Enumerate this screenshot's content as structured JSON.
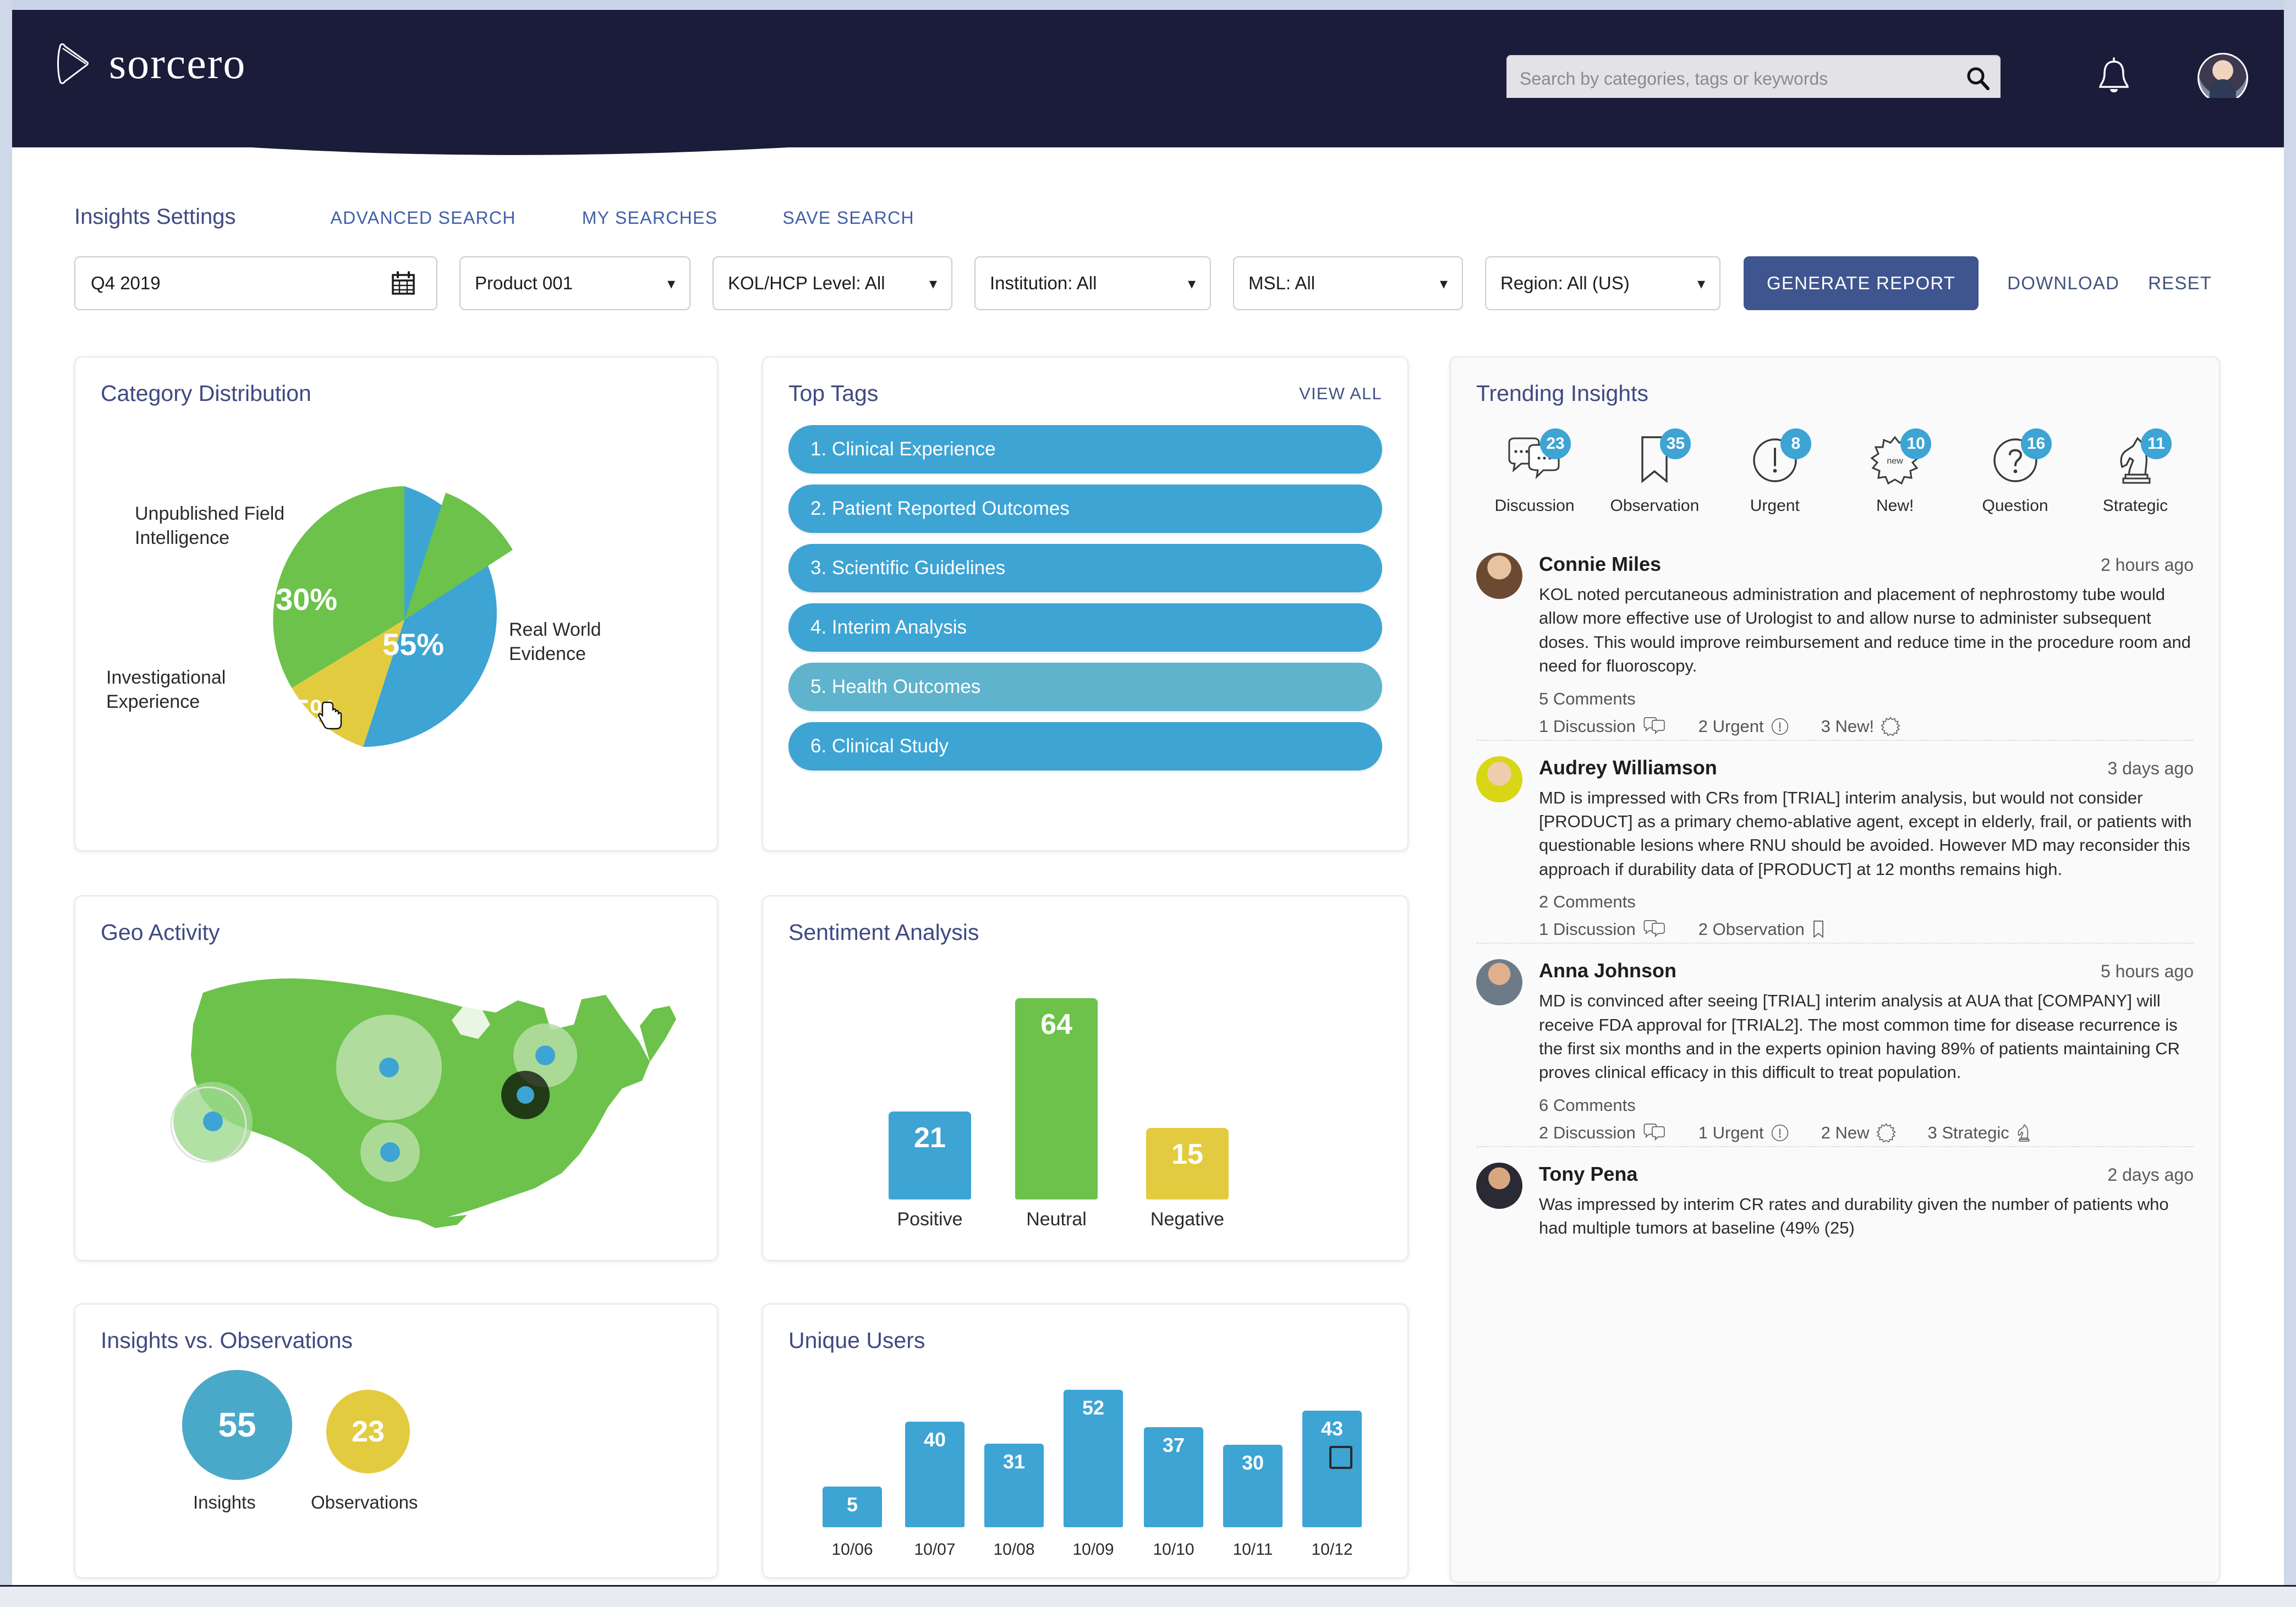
{
  "header": {
    "brand": "sorcero",
    "search_placeholder": "Search by categories, tags or keywords",
    "search_value": "",
    "icons": {
      "search": "search-icon",
      "bell": "bell-icon",
      "avatar": "user-avatar"
    }
  },
  "settings": {
    "title": "Insights Settings",
    "links": [
      "ADVANCED SEARCH",
      "MY SEARCHES",
      "SAVE SEARCH"
    ],
    "date_value": "Q4 2019",
    "filters": [
      {
        "name": "product",
        "value": "Product 001"
      },
      {
        "name": "kol-level",
        "value": "KOL/HCP Level: All"
      },
      {
        "name": "institution",
        "value": "Institution: All"
      },
      {
        "name": "msl",
        "value": "MSL: All"
      },
      {
        "name": "region",
        "value": "Region: All (US)"
      }
    ],
    "generate_label": "GENERATE REPORT",
    "download_label": "DOWNLOAD",
    "reset_label": "RESET"
  },
  "cards": {
    "category": {
      "title": "Category Distribution"
    },
    "toptags": {
      "title": "Top Tags",
      "view_all": "VIEW ALL"
    },
    "geo": {
      "title": "Geo Activity"
    },
    "sentiment": {
      "title": "Sentiment Analysis"
    },
    "insobs": {
      "title": "Insights vs. Observations"
    },
    "unique": {
      "title": "Unique Users"
    },
    "trending": {
      "title": "Trending Insights"
    }
  },
  "top_tags": [
    "1. Clinical Experience",
    "2. Patient Reported Outcomes",
    "3. Scientific Guidelines",
    "4. Interim Analysis",
    "5. Health Outcomes",
    "6. Clinical Study"
  ],
  "trending_icons": [
    {
      "label": "Discussion",
      "count": "23",
      "icon": "discussion-icon"
    },
    {
      "label": "Observation",
      "count": "35",
      "icon": "bookmark-icon"
    },
    {
      "label": "Urgent",
      "count": "8",
      "icon": "exclamation-icon"
    },
    {
      "label": "New!",
      "count": "10",
      "icon": "starburst-new-icon"
    },
    {
      "label": "Question",
      "count": "16",
      "icon": "question-icon"
    },
    {
      "label": "Strategic",
      "count": "11",
      "icon": "chess-knight-icon"
    }
  ],
  "feed": [
    {
      "name": "Connie Miles",
      "time": "2 hours ago",
      "text": "KOL noted percutaneous administration and placement of nephrostomy tube would allow more effective use of Urologist to and allow nurse to administer subsequent doses. This would improve reimbursement and reduce time in the procedure room and need for fluoroscopy.",
      "comments": "5 Comments",
      "tags": [
        {
          "label": "1 Discussion",
          "icon": "discussion-icon"
        },
        {
          "label": "2 Urgent",
          "icon": "exclamation-icon"
        },
        {
          "label": "3 New!",
          "icon": "starburst-new-icon"
        }
      ]
    },
    {
      "name": "Audrey Williamson",
      "time": "3 days ago",
      "text": "MD is impressed with CRs from [TRIAL] interim analysis, but would not consider [PRODUCT] as a primary chemo-ablative agent, except in elderly, frail, or patients with questionable lesions where RNU should be avoided. However MD may reconsider this approach if durability data of [PRODUCT] at 12 months remains high.",
      "comments": "2 Comments",
      "tags": [
        {
          "label": "1 Discussion",
          "icon": "discussion-icon"
        },
        {
          "label": "2 Observation",
          "icon": "bookmark-icon"
        }
      ]
    },
    {
      "name": "Anna Johnson",
      "time": "5 hours ago",
      "text": "MD is convinced after seeing [TRIAL] interim analysis at AUA that [COMPANY] will receive FDA approval for [TRIAL2]. The most common time for disease recurrence is the first six months and in the experts opinion having 89% of patients maintaining CR proves clinical efficacy in this difficult to treat population.",
      "comments": "6 Comments",
      "tags": [
        {
          "label": "2 Discussion",
          "icon": "discussion-icon"
        },
        {
          "label": "1 Urgent",
          "icon": "exclamation-icon"
        },
        {
          "label": "2 New",
          "icon": "starburst-new-icon"
        },
        {
          "label": "3 Strategic",
          "icon": "chess-knight-icon"
        }
      ]
    },
    {
      "name": "Tony Pena",
      "time": "2 days ago",
      "text": "Was impressed by interim CR rates and durability given the number of patients who had multiple tumors at baseline (49% (25)",
      "comments": "",
      "tags": []
    }
  ],
  "chart_data": [
    {
      "type": "pie",
      "title": "Category Distribution",
      "categories": [
        "Real World Evidence",
        "Unpublished Field Intelligence",
        "Investigational Experience"
      ],
      "values": [
        55,
        30,
        15
      ],
      "labels": [
        "55%",
        "30%",
        "15%"
      ],
      "colors": [
        "#3da4d4",
        "#6cc24a",
        "#e3cb3f"
      ],
      "legend": "inline-callouts"
    },
    {
      "type": "bar",
      "title": "Sentiment Analysis",
      "categories": [
        "Positive",
        "Neutral",
        "Negative"
      ],
      "values": [
        21,
        64,
        15
      ],
      "colors": [
        "#3da4d4",
        "#6cc24a",
        "#e3cb3f"
      ],
      "ylim": [
        0,
        64
      ],
      "grid": false,
      "xlabel": "",
      "ylabel": ""
    },
    {
      "type": "bar",
      "title": "Insights vs. Observations",
      "categories": [
        "Insights",
        "Observations"
      ],
      "values": [
        55,
        23
      ],
      "colors": [
        "#4aa9c9",
        "#e3cb3f"
      ],
      "render": "bubble"
    },
    {
      "type": "bar",
      "title": "Unique Users",
      "categories": [
        "10/06",
        "10/07",
        "10/08",
        "10/09",
        "10/10",
        "10/11",
        "10/12"
      ],
      "values": [
        5,
        40,
        31,
        52,
        37,
        30,
        43
      ],
      "colors": [
        "#3da4d4"
      ],
      "ylim": [
        0,
        52
      ],
      "grid": false,
      "xlabel": "",
      "ylabel": ""
    },
    {
      "type": "map",
      "title": "Geo Activity",
      "region": "United States",
      "markers": [
        {
          "x": 16,
          "y": 62,
          "size": "large"
        },
        {
          "x": 48,
          "y": 42,
          "size": "xlarge"
        },
        {
          "x": 76,
          "y": 36,
          "size": "medium"
        },
        {
          "x": 70,
          "y": 52,
          "size": "small"
        },
        {
          "x": 49,
          "y": 76,
          "size": "medium"
        }
      ],
      "land_color": "#6cc24a",
      "marker_color": "#3da4d4"
    }
  ],
  "colors": {
    "brand_navy": "#1b1b3a",
    "accent_blue": "#3da4d4",
    "accent_green": "#6cc24a",
    "accent_yellow": "#e3cb3f",
    "button_blue": "#3e5590",
    "heading_blue": "#3f4a82"
  }
}
